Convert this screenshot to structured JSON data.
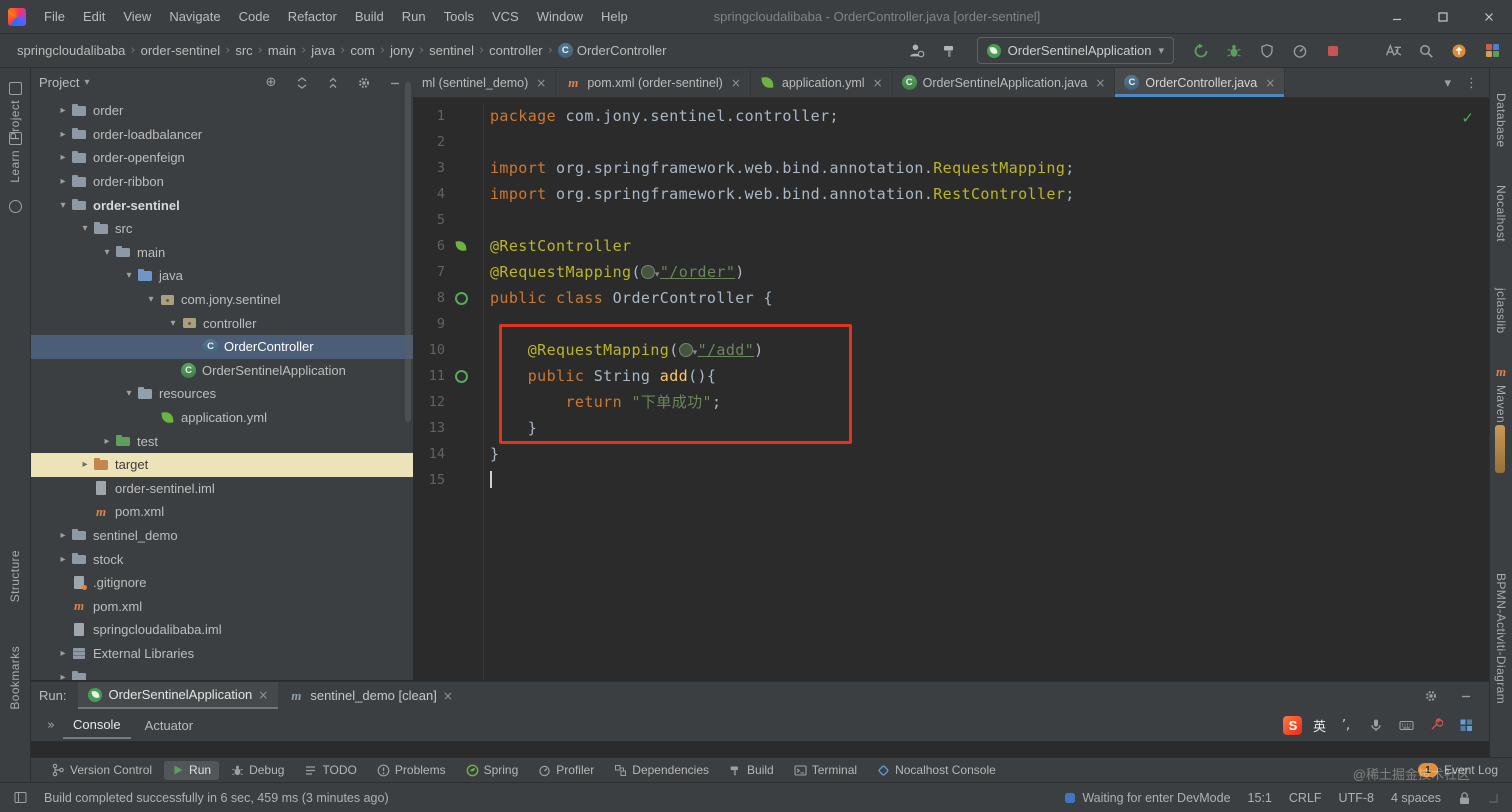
{
  "window": {
    "title": "springcloudalibaba - OrderController.java [order-sentinel]",
    "menus": [
      "File",
      "Edit",
      "View",
      "Navigate",
      "Code",
      "Refactor",
      "Build",
      "Run",
      "Tools",
      "VCS",
      "Window",
      "Help"
    ],
    "controls": [
      "minimize",
      "maximize",
      "close"
    ]
  },
  "navbar": {
    "breadcrumbs": [
      "springcloudalibaba",
      "order-sentinel",
      "src",
      "main",
      "java",
      "com",
      "jony",
      "sentinel",
      "controller",
      "OrderController"
    ],
    "run_config": "OrderSentinelApplication",
    "icons_pre": [
      "user-settings",
      "build-hammer"
    ],
    "icons_run": [
      "rerun",
      "debug",
      "coverage",
      "profiler",
      "stop"
    ],
    "icons_misc": [
      "translate",
      "search",
      "update",
      "plugin-grid"
    ]
  },
  "left_stripe": {
    "project": "Project",
    "learn": "Learn",
    "structure": "Structure",
    "bookmarks": "Bookmarks"
  },
  "right_stripe": {
    "database": "Database",
    "nocalhost": "Nocalhost",
    "jclasslib": "jclasslib",
    "maven": "Maven",
    "bpmn": "BPMN-Activiti-Diagram"
  },
  "project_panel": {
    "title": "Project",
    "icons": [
      "locate",
      "scroll-src",
      "collapse-all",
      "gear",
      "hide"
    ],
    "tree": [
      {
        "label": "order",
        "level": 0,
        "chevron": "c",
        "icon": "folder"
      },
      {
        "label": "order-loadbalancer",
        "level": 0,
        "chevron": "c",
        "icon": "folder"
      },
      {
        "label": "order-openfeign",
        "level": 0,
        "chevron": "c",
        "icon": "folder"
      },
      {
        "label": "order-ribbon",
        "level": 0,
        "chevron": "c",
        "icon": "folder"
      },
      {
        "label": "order-sentinel",
        "level": 0,
        "chevron": "e",
        "icon": "folder",
        "bold": true
      },
      {
        "label": "src",
        "level": 1,
        "chevron": "e",
        "icon": "folder"
      },
      {
        "label": "main",
        "level": 2,
        "chevron": "e",
        "icon": "folder"
      },
      {
        "label": "java",
        "level": 3,
        "chevron": "e",
        "icon": "folder-java"
      },
      {
        "label": "com.jony.sentinel",
        "level": 4,
        "chevron": "e",
        "icon": "pkg"
      },
      {
        "label": "controller",
        "level": 5,
        "chevron": "e",
        "icon": "pkg"
      },
      {
        "label": "OrderController",
        "level": 6,
        "icon": "class-blue",
        "selected": true
      },
      {
        "label": "OrderSentinelApplication",
        "level": 5,
        "icon": "class-green"
      },
      {
        "label": "resources",
        "level": 3,
        "chevron": "e",
        "icon": "folder-res"
      },
      {
        "label": "application.yml",
        "level": 4,
        "icon": "leaf"
      },
      {
        "label": "test",
        "level": 2,
        "chevron": "c",
        "icon": "folder-test"
      },
      {
        "label": "target",
        "level": 1,
        "chevron": "c",
        "icon": "folder-target",
        "highlight": true
      },
      {
        "label": "order-sentinel.iml",
        "level": 1,
        "icon": "file"
      },
      {
        "label": "pom.xml",
        "level": 1,
        "icon": "maven"
      },
      {
        "label": "sentinel_demo",
        "level": 0,
        "chevron": "c",
        "icon": "folder"
      },
      {
        "label": "stock",
        "level": 0,
        "chevron": "c",
        "icon": "folder"
      },
      {
        "label": ".gitignore",
        "level": 0,
        "icon": "file-git"
      },
      {
        "label": "pom.xml",
        "level": 0,
        "icon": "maven"
      },
      {
        "label": "springcloudalibaba.iml",
        "level": 0,
        "icon": "file"
      },
      {
        "label": "External Libraries",
        "level": 0,
        "chevron": "c",
        "icon": "lib"
      },
      {
        "label": "",
        "level": 0,
        "chevron": "c",
        "icon": "folder"
      }
    ]
  },
  "editor": {
    "tabs": [
      {
        "label": "ml (sentinel_demo)",
        "icon": "",
        "active": false
      },
      {
        "label": "pom.xml (order-sentinel)",
        "icon": "maven",
        "active": false
      },
      {
        "label": "application.yml",
        "icon": "leaf",
        "active": false
      },
      {
        "label": "OrderSentinelApplication.java",
        "icon": "class-green",
        "active": false
      },
      {
        "label": "OrderController.java",
        "icon": "class-blue",
        "active": true
      }
    ],
    "actions": [
      "chevdown",
      "more"
    ],
    "status_icon": "check",
    "lines": [
      {
        "n": 1,
        "segs": [
          {
            "t": "package ",
            "c": "k"
          },
          {
            "t": "com.jony.sentinel.controller;",
            "c": "p"
          }
        ]
      },
      {
        "n": 2,
        "segs": []
      },
      {
        "n": 3,
        "segs": [
          {
            "t": "import ",
            "c": "k"
          },
          {
            "t": "org.springframework.web.bind.annotation.",
            "c": "p"
          },
          {
            "t": "RequestMapping",
            "c": "a"
          },
          {
            "t": ";",
            "c": "p"
          }
        ]
      },
      {
        "n": 4,
        "segs": [
          {
            "t": "import ",
            "c": "k"
          },
          {
            "t": "org.springframework.web.bind.annotation.",
            "c": "p"
          },
          {
            "t": "RestController",
            "c": "a"
          },
          {
            "t": ";",
            "c": "p"
          }
        ]
      },
      {
        "n": 5,
        "segs": []
      },
      {
        "n": 6,
        "gicon": "gleaf",
        "segs": [
          {
            "t": "@RestController",
            "c": "a"
          }
        ]
      },
      {
        "n": 7,
        "segs": [
          {
            "t": "@RequestMapping",
            "c": "a"
          },
          {
            "t": "(",
            "c": "p"
          },
          {
            "ic": "urlnav"
          },
          {
            "t": "\"/order\"",
            "c": "su"
          },
          {
            "t": ")",
            "c": "p"
          }
        ]
      },
      {
        "n": 8,
        "gicon": "gbean",
        "segs": [
          {
            "t": "public class ",
            "c": "k"
          },
          {
            "t": "OrderController {",
            "c": "p"
          }
        ]
      },
      {
        "n": 9,
        "segs": []
      },
      {
        "n": 10,
        "segs": [
          {
            "t": "    ",
            "c": "p"
          },
          {
            "t": "@RequestMapping",
            "c": "a"
          },
          {
            "t": "(",
            "c": "p"
          },
          {
            "ic": "urlnav"
          },
          {
            "t": "\"/add\"",
            "c": "su"
          },
          {
            "t": ")",
            "c": "p"
          }
        ]
      },
      {
        "n": 11,
        "gicon": "gbean",
        "segs": [
          {
            "t": "    ",
            "c": "p"
          },
          {
            "t": "public ",
            "c": "k"
          },
          {
            "t": "String ",
            "c": "p"
          },
          {
            "t": "add",
            "c": "m"
          },
          {
            "t": "(){",
            "c": "p"
          }
        ]
      },
      {
        "n": 12,
        "segs": [
          {
            "t": "        ",
            "c": "p"
          },
          {
            "t": "return ",
            "c": "k"
          },
          {
            "t": "\"下单成功\"",
            "c": "s"
          },
          {
            "t": ";",
            "c": "p"
          }
        ]
      },
      {
        "n": 13,
        "segs": [
          {
            "t": "    }",
            "c": "p"
          }
        ]
      },
      {
        "n": 14,
        "segs": [
          {
            "t": "}",
            "c": "p"
          }
        ]
      },
      {
        "n": 15,
        "caret": true,
        "segs": []
      }
    ]
  },
  "run_panel": {
    "label": "Run:",
    "tabs": [
      {
        "label": "OrderSentinelApplication",
        "icon": "boot",
        "active": true
      },
      {
        "label": "sentinel_demo [clean]",
        "icon": "conf",
        "active": false
      }
    ],
    "actions": [
      "gear",
      "hide"
    ],
    "subtabs": [
      {
        "label": "Console",
        "active": true
      },
      {
        "label": "Actuator",
        "active": false
      }
    ],
    "ime": {
      "lang": "英",
      "icons": [
        "sogou",
        "lang",
        "punct",
        "mic",
        "keyboard",
        "tool",
        "grid"
      ]
    }
  },
  "bottom_bar": {
    "items": [
      {
        "label": "Version Control",
        "icon": "branch"
      },
      {
        "label": "Run",
        "icon": "play",
        "active": true
      },
      {
        "label": "Debug",
        "icon": "bug2"
      },
      {
        "label": "TODO",
        "icon": "todo"
      },
      {
        "label": "Problems",
        "icon": "problem"
      },
      {
        "label": "Spring",
        "icon": "springb"
      },
      {
        "label": "Profiler",
        "icon": "gauge"
      },
      {
        "label": "Dependencies",
        "icon": "deps"
      },
      {
        "label": "Build",
        "icon": "hammer2"
      },
      {
        "label": "Terminal",
        "icon": "term"
      },
      {
        "label": "Nocalhost Console",
        "icon": "noca"
      }
    ],
    "event_log": {
      "label": "Event Log",
      "badge": "1"
    }
  },
  "status_bar": {
    "message": "Build completed successfully in 6 sec, 459 ms (3 minutes ago)",
    "items": [
      {
        "name": "devmode-status",
        "icon": "noca-blue",
        "text": "Waiting for enter DevMode"
      },
      {
        "name": "caret-position",
        "text": "15:1"
      },
      {
        "name": "line-separator",
        "text": "CRLF"
      },
      {
        "name": "file-encoding",
        "text": "UTF-8"
      },
      {
        "name": "indent-setting",
        "text": "4 spaces"
      },
      {
        "name": "lock",
        "icon": "lock"
      },
      {
        "name": "resize-grip",
        "icon": "grip"
      }
    ]
  },
  "watermark": "@稀土掘金技术社区"
}
